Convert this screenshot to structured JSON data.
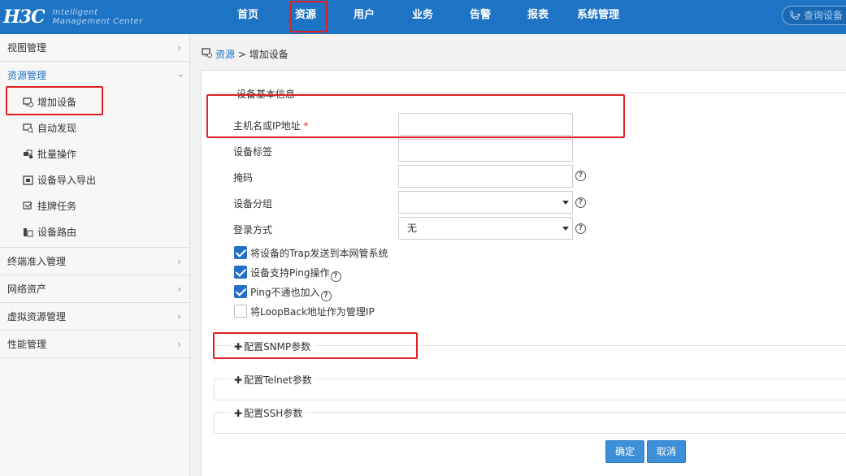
{
  "app": {
    "logo": "H3C",
    "logo_sub_line1": "Intelligent",
    "logo_sub_line2": "Management Center"
  },
  "nav": {
    "items": [
      "首页",
      "资源",
      "用户",
      "业务",
      "告警",
      "报表",
      "系统管理"
    ],
    "active": "资源",
    "search_placeholder": "查询设备"
  },
  "sidebar": {
    "sections": [
      {
        "label": "视图管理",
        "open": false
      },
      {
        "label": "资源管理",
        "open": true,
        "items": [
          "增加设备",
          "自动发现",
          "批量操作",
          "设备导入导出",
          "挂牌任务",
          "设备路由"
        ]
      },
      {
        "label": "终端准入管理",
        "open": false
      },
      {
        "label": "网络资产",
        "open": false
      },
      {
        "label": "虚拟资源管理",
        "open": false
      },
      {
        "label": "性能管理",
        "open": false
      }
    ]
  },
  "breadcrumb": {
    "root": "资源",
    "sep": ">",
    "current": "增加设备"
  },
  "form": {
    "section_title": "设备基本信息",
    "host_label": "主机名或IP地址",
    "required_mark": "*",
    "host_value": "",
    "tag_label": "设备标签",
    "tag_value": "",
    "mask_label": "掩码",
    "mask_value": "",
    "group_label": "设备分组",
    "group_value": "",
    "login_label": "登录方式",
    "login_value": "无",
    "help_glyph": "?",
    "checkboxes": [
      {
        "label": "将设备的Trap发送到本网管系统",
        "checked": true,
        "help": false
      },
      {
        "label": "设备支持Ping操作",
        "checked": true,
        "help": true
      },
      {
        "label": "Ping不通也加入",
        "checked": true,
        "help": true
      },
      {
        "label": "将LoopBack地址作为管理IP",
        "checked": false,
        "help": false
      }
    ],
    "folds": [
      "配置SNMP参数",
      "配置Telnet参数",
      "配置SSH参数"
    ],
    "fold_plus": "✚",
    "ok_label": "确定",
    "cancel_label": "取消"
  },
  "colors": {
    "topbar": "#1d73c4",
    "highlight": "#e02020",
    "button": "#3d8fd8"
  }
}
